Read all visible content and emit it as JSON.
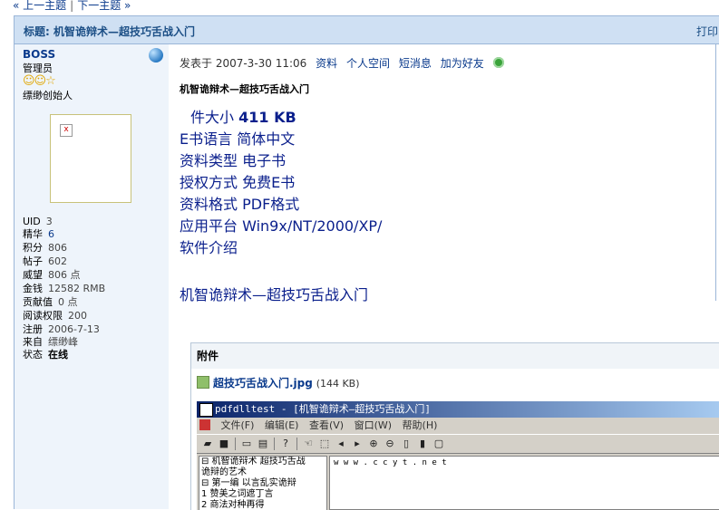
{
  "nav": {
    "prev": "« 上一主题",
    "sep": "|",
    "next": "下一主题 »"
  },
  "thread": {
    "title": "标题: 机智诡辩术—超技巧舌战入门",
    "print": "打印"
  },
  "author": {
    "name": "BOSS",
    "role": "管理员",
    "stars_glyph": "☺☺☆",
    "member_title": "缥缈创始人",
    "stats": [
      {
        "label": "UID",
        "value": "3"
      },
      {
        "label": "精华",
        "value": "6"
      },
      {
        "label": "积分",
        "value": "806"
      },
      {
        "label": "帖子",
        "value": "602"
      },
      {
        "label": "威望",
        "value": "806 点"
      },
      {
        "label": "金钱",
        "value": "12582 RMB"
      },
      {
        "label": "贡献值",
        "value": "0 点"
      },
      {
        "label": "阅读权限",
        "value": "200"
      },
      {
        "label": "注册",
        "value": "2006-7-13"
      },
      {
        "label": "来自",
        "value": "缥缈峰"
      },
      {
        "label": "状态",
        "value": "在线"
      }
    ]
  },
  "post": {
    "meta_prefix": "发表于 2007-3-30 11:06",
    "links": [
      "资料",
      "个人空间",
      "短消息",
      "加为好友"
    ],
    "subject": "机智诡辩术—超技巧舌战入门",
    "lines": [
      {
        "label": "件大小",
        "value": "411 KB"
      },
      {
        "label": "E书语言",
        "value": "简体中文"
      },
      {
        "label": "资料类型",
        "value": "电子书"
      },
      {
        "label": "授权方式",
        "value": "免费E书"
      },
      {
        "label": "资料格式",
        "value": "PDF格式"
      },
      {
        "label": "应用平台",
        "value": "Win9x/NT/2000/XP/"
      },
      {
        "label": "软件介绍",
        "value": ""
      }
    ],
    "final_line": "机智诡辩术—超技巧舌战入门"
  },
  "attachment": {
    "header": "附件",
    "filename": "超技巧舌战入门.jpg",
    "size": "(144 KB)"
  },
  "screenshot_window": {
    "title": "pdfdlltest - [机智诡辩术—超技巧舌战入门]",
    "menu": [
      "文件(F)",
      "编辑(E)",
      "查看(V)",
      "窗口(W)",
      "帮助(H)"
    ],
    "tree": [
      "⊟ 机智诡辩术 超技巧舌战",
      "  诡辩的艺术",
      "  ⊟ 第一编 以言乱实诡辩",
      "    1 赞美之词遮丁言",
      "    2 商法对种再得"
    ],
    "content": "w w w . c c y t . n e t"
  }
}
